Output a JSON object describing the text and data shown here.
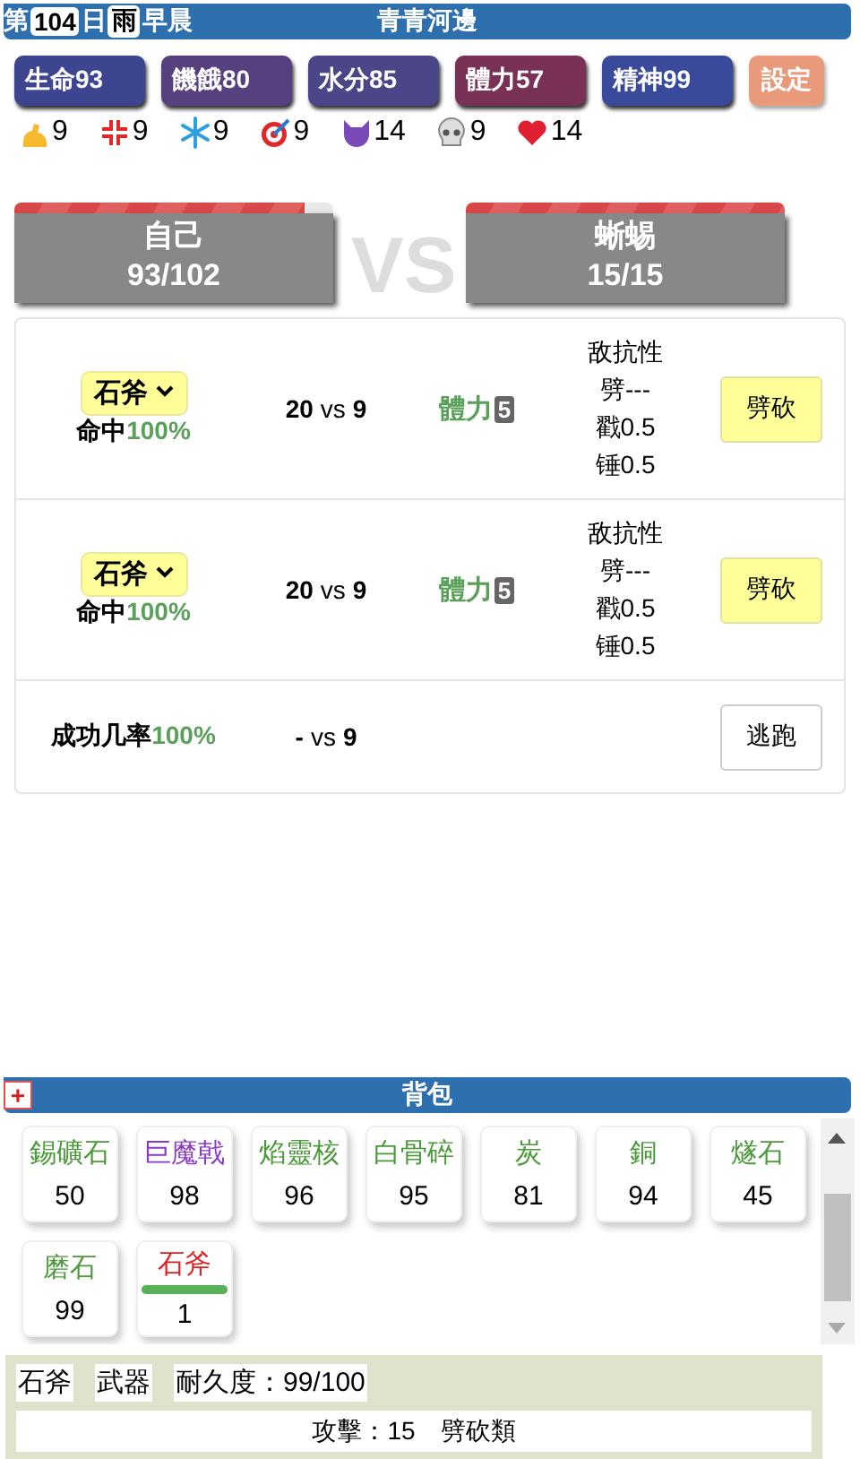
{
  "header": {
    "day_prefix": "第",
    "day": "104",
    "day_suffix": "日",
    "weather": "雨",
    "time": "早晨",
    "location": "青青河邊"
  },
  "stats": [
    {
      "label": "生命93",
      "kind": "stat",
      "color": "#3d4590"
    },
    {
      "label": "饑餓80",
      "kind": "stat",
      "color": "#56407e"
    },
    {
      "label": "水分85",
      "kind": "stat",
      "color": "#4b4688"
    },
    {
      "label": "體力57",
      "kind": "stat",
      "color": "#7a3156"
    },
    {
      "label": "精神99",
      "kind": "stat",
      "color": "#3a4a9a"
    },
    {
      "label": "設定",
      "kind": "settings",
      "color": "#e99a7a"
    }
  ],
  "attributes": [
    {
      "value": "9"
    },
    {
      "value": "9"
    },
    {
      "value": "9"
    },
    {
      "value": "9"
    },
    {
      "value": "14"
    },
    {
      "value": "9"
    },
    {
      "value": "14"
    }
  ],
  "fighters": [
    {
      "name": "自己",
      "hp": "93/102",
      "level": 0.91
    },
    {
      "name": "蜥蜴",
      "hp": "15/15",
      "level": 1
    }
  ],
  "vs": "VS",
  "actions": [
    {
      "kind": "attack",
      "weapon": "石斧",
      "hit_label": "命中",
      "hit": "100%",
      "mine": "20",
      "vs": "vs",
      "theirs": "9",
      "cost_label": "體力",
      "cost": "5",
      "resist": [
        "敌抗性",
        "劈---",
        "戳0.5",
        "锤0.5"
      ],
      "button": "劈砍"
    },
    {
      "kind": "attack",
      "weapon": "石斧",
      "hit_label": "命中",
      "hit": "100%",
      "mine": "20",
      "vs": "vs",
      "theirs": "9",
      "cost_label": "體力",
      "cost": "5",
      "resist": [
        "敌抗性",
        "劈---",
        "戳0.5",
        "锤0.5"
      ],
      "button": "劈砍"
    },
    {
      "kind": "flee",
      "hit_label": "成功几率",
      "hit": "100%",
      "mine": "-",
      "vs": "vs",
      "theirs": "9",
      "button": "逃跑"
    }
  ],
  "bag": {
    "expand": "+",
    "title": "背包",
    "items": [
      {
        "name": "錫礦石",
        "count": "50",
        "color": "#4a9a3a"
      },
      {
        "name": "巨魔戟",
        "count": "98",
        "color": "#8a3ac8"
      },
      {
        "name": "焰靈核",
        "count": "96",
        "color": "#4a9a3a"
      },
      {
        "name": "白骨碎",
        "count": "95",
        "color": "#4a9a3a"
      },
      {
        "name": "炭",
        "count": "81",
        "color": "#4a9a3a"
      },
      {
        "name": "銅",
        "count": "94",
        "color": "#4a9a3a"
      },
      {
        "name": "燧石",
        "count": "45",
        "color": "#4a9a3a"
      },
      {
        "name": "磨石",
        "count": "99",
        "color": "#4a9a3a"
      },
      {
        "name": "石斧",
        "count": "1",
        "color": "#e02020",
        "level": 0.99
      }
    ]
  },
  "detail": {
    "tags": [
      "石斧",
      "武器",
      "耐久度：99/100"
    ],
    "description": "攻擊：15　劈砍類"
  }
}
